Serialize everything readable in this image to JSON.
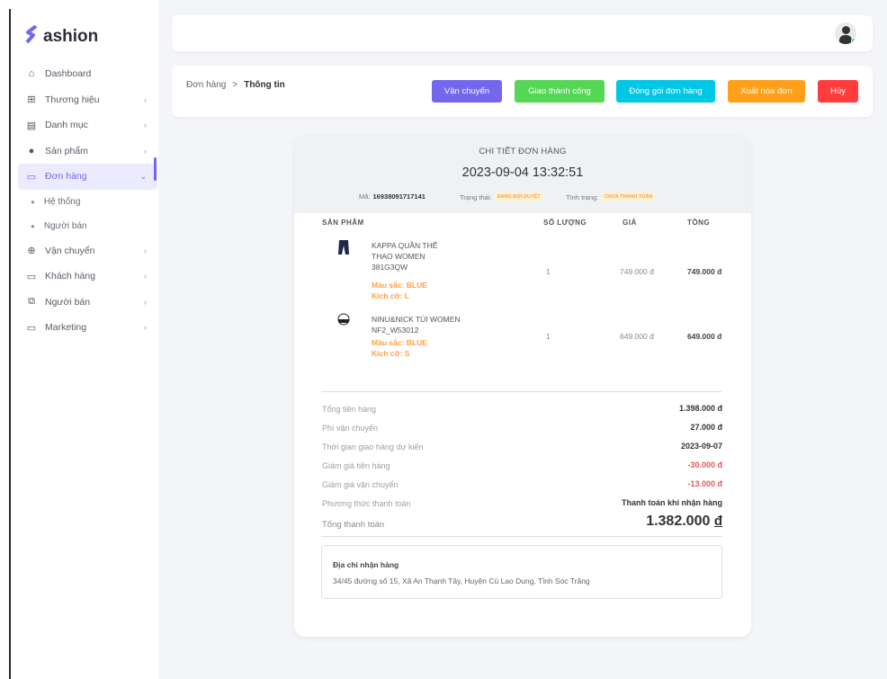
{
  "brand": {
    "name": "ashion",
    "mark": "S"
  },
  "sidebar": {
    "items": [
      {
        "label": "Dashboard",
        "icon": "home-icon",
        "glyph": "⌂",
        "chev": ""
      },
      {
        "label": "Thương hiệu",
        "icon": "table-icon",
        "glyph": "⊞",
        "chev": "›"
      },
      {
        "label": "Danh mục",
        "icon": "list-icon",
        "glyph": "▤",
        "chev": "›"
      },
      {
        "label": "Sản phẩm",
        "icon": "product-icon",
        "glyph": "●",
        "chev": "›"
      },
      {
        "label": "Đơn hàng",
        "icon": "archive-icon",
        "glyph": "▭",
        "chev": "⌄",
        "active": true
      },
      {
        "label": "Vận chuyển",
        "icon": "shipping-icon",
        "glyph": "⊕",
        "chev": "›"
      },
      {
        "label": "Khách hàng",
        "icon": "customer-icon",
        "glyph": "▭",
        "chev": "›"
      },
      {
        "label": "Người bán",
        "icon": "seller-icon",
        "glyph": "⧉",
        "chev": "›"
      },
      {
        "label": "Marketing",
        "icon": "marketing-icon",
        "glyph": "▭",
        "chev": "›"
      }
    ],
    "subitems": [
      "Hệ thống",
      "Người bán"
    ]
  },
  "breadcrumb": {
    "parent": "Đơn hàng",
    "sep": ">",
    "current": "Thông tin"
  },
  "actions": {
    "ship": "Vận chuyển",
    "delivered": "Giao thành công",
    "pack": "Đóng gói đơn hàng",
    "invoice": "Xuất hóa đơn",
    "cancel": "Hủy"
  },
  "colors": {
    "primary": "#7367f0",
    "success": "#55d654",
    "info": "#00c7e6",
    "warning": "#ff9f1a",
    "danger": "#ff3d3d"
  },
  "order": {
    "title": "CHI TIẾT ĐƠN HÀNG",
    "datetime": "2023-09-04 13:32:51",
    "code_label": "Mã:",
    "code": "16938091717141",
    "status_label": "Trạng thái:",
    "status": "ĐANG ĐỢI DUYỆT",
    "payment_label": "Tình trạng:",
    "payment": "CHƯA THANH TOÁN"
  },
  "table": {
    "headers": {
      "product": "SẢN PHẨM",
      "qty": "SỐ LƯỢNG",
      "price": "GIÁ",
      "total": "TỔNG"
    },
    "rows": [
      {
        "icon": "pants-icon",
        "name": "KAPPA QUẦN THỂ THAO WOMEN 381G3QW",
        "color": "Màu sắc: BLUE",
        "size": "Kích cỡ: L",
        "qty": "1",
        "price": "749.000 đ",
        "total": "749.000 đ"
      },
      {
        "icon": "bag-icon",
        "name": "NINU&NICK TÚI WOMEN NF2_W53012",
        "color": "Màu sắc: BLUE",
        "size": "Kích cỡ: S",
        "qty": "1",
        "price": "649.000 đ",
        "total": "649.000 đ"
      }
    ]
  },
  "summary": {
    "subtotal_label": "Tổng tiền hàng",
    "subtotal": "1.398.000 đ",
    "shipping_label": "Phí vận chuyển",
    "shipping": "27.000 đ",
    "eta_label": "Thời gian giao hàng dự kiến",
    "eta": "2023-09-07",
    "discount_label": "Giảm giá tiền hàng",
    "discount": "-30.000 đ",
    "ship_discount_label": "Giảm giá vận chuyển",
    "ship_discount": "-13.000 đ",
    "method_label": "Phương thức thanh toán",
    "method": "Thanh toán khi nhận hàng",
    "grand_label": "Tổng thanh toán",
    "grand": "1.382.000",
    "currency": "đ"
  },
  "address": {
    "title": "Địa chỉ nhận hàng",
    "text": "34/45 đường số 15, Xã An Thạnh Tây, Huyện Cù Lao Dung, Tỉnh Sóc Trăng"
  }
}
